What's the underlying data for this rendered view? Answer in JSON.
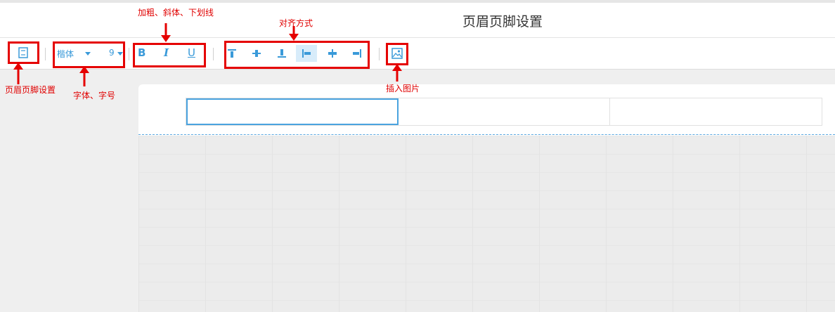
{
  "window": {
    "title": "页眉页脚设置"
  },
  "toolbar": {
    "font_name": "楷体",
    "font_size": "9",
    "bold_label": "B",
    "italic_label": "I",
    "underline_label": "U"
  },
  "annotations": {
    "header_footer_settings": "页眉页脚设置",
    "font_and_size": "字体、字号",
    "bold_italic_underline": "加粗、斜体、下划线",
    "alignment": "对齐方式",
    "insert_image": "插入图片"
  },
  "colors": {
    "accent": "#3a9ad9",
    "annotation": "#e00000"
  },
  "icons": {
    "header_footer": "page-layout-icon",
    "align_top": "align-top-icon",
    "align_middle": "align-middle-icon",
    "align_bottom": "align-bottom-icon",
    "align_left": "align-left-icon",
    "align_center": "align-center-icon",
    "align_right": "align-right-icon",
    "insert_image": "image-icon"
  }
}
